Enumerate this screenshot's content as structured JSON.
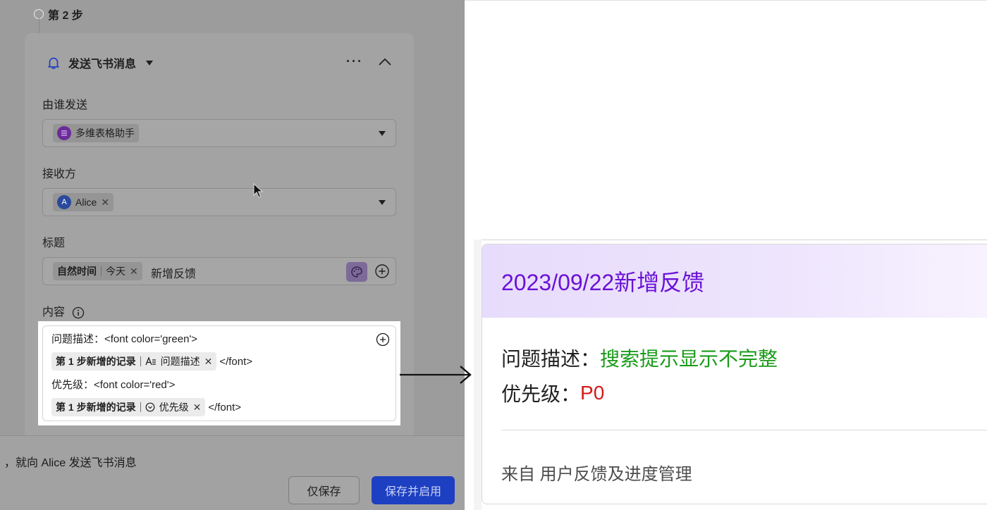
{
  "step": {
    "label": "第 2 步"
  },
  "action_card": {
    "title": "发送飞书消息",
    "more_label": "···",
    "icons": {
      "header": "bell-icon",
      "collapse": "chevron-up-icon"
    }
  },
  "sender": {
    "label": "由谁发送",
    "value": "多维表格助手"
  },
  "receiver": {
    "label": "接收方",
    "user_initial": "A",
    "user_name": "Alice"
  },
  "title_field": {
    "label": "标题",
    "chip_main": "自然时间",
    "chip_sub": "今天",
    "text": "新增反馈"
  },
  "content_field": {
    "label": "内容",
    "line1_text": "问题描述：<font color='green'>",
    "chip1_step": "第 1 步新增的记录",
    "chip1_field": "问题描述",
    "chip1_close": "</font>",
    "line3_text": "优先级：<font color='red'>",
    "chip2_step": "第 1 步新增的记录",
    "chip2_field": "优先级",
    "chip2_close": "</font>"
  },
  "footer": {
    "summary": "，就向 Alice 发送飞书消息",
    "save_label": "仅保存",
    "save_enable_label": "保存并启用"
  },
  "preview": {
    "title": "2023/09/22新增反馈",
    "line1_label": "问题描述：",
    "line1_value": "搜索提示显示不完整",
    "line2_label": "优先级：",
    "line2_value": "P0",
    "footer": "来自 用户反馈及进度管理"
  },
  "colors": {
    "preview_title": "#6b12d6",
    "value_green": "#1a9b1a",
    "value_red": "#d41a1a",
    "primary_button": "#1d3fc1"
  }
}
